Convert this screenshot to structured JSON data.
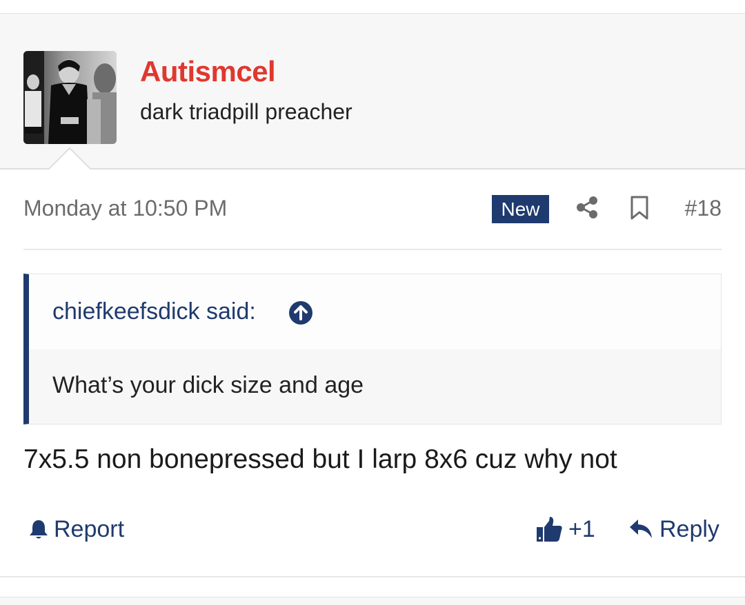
{
  "user": {
    "name": "Autismcel",
    "title": "dark triadpill preacher",
    "avatar_icon": "user-avatar-photo",
    "name_color": "#e0382e"
  },
  "post": {
    "timestamp": "Monday at 10:50 PM",
    "new_badge": "New",
    "share_icon": "share-icon",
    "bookmark_icon": "bookmark-icon",
    "number": "#18",
    "quote": {
      "attribution": "chiefkeefsdick said:",
      "jump_icon": "arrow-up-circle-icon",
      "text": "What’s your dick size and age"
    },
    "body": "7x5.5 non bonepressed but I larp 8x6 cuz why not"
  },
  "actions": {
    "report_label": "Report",
    "like_count": "+1",
    "reply_label": "Reply"
  },
  "colors": {
    "accent": "#1f3a6e",
    "header_bg": "#f7f7f7"
  }
}
